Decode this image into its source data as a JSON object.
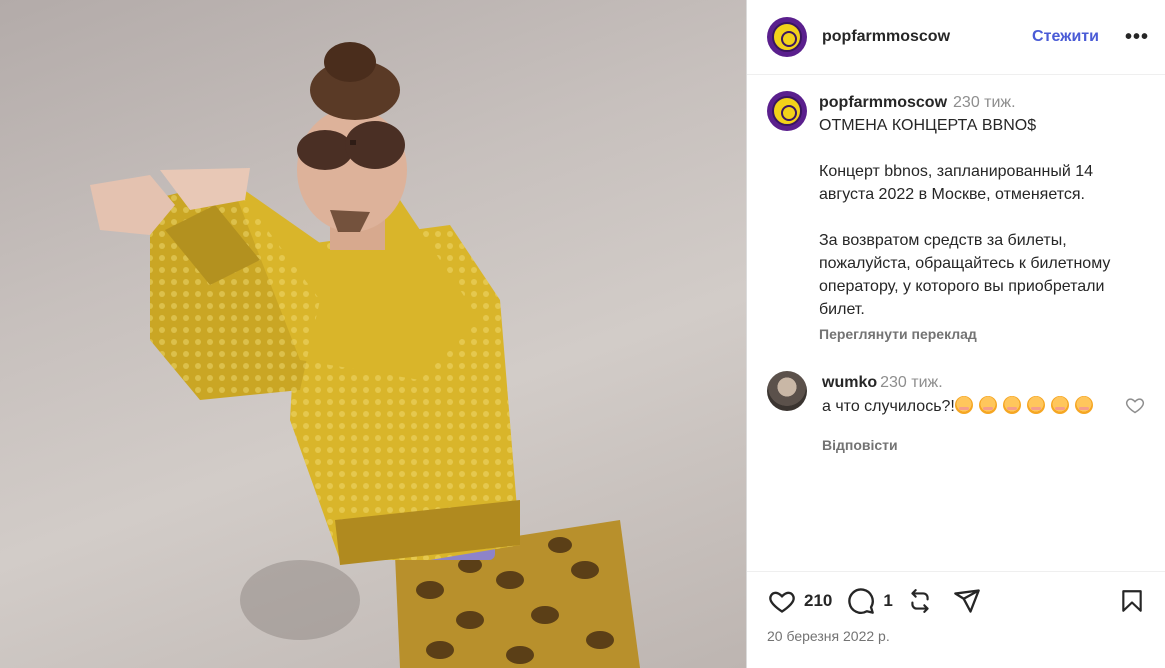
{
  "header": {
    "username": "popfarmmoscow",
    "follow_label": "Стежити",
    "more_label": "•••"
  },
  "caption": {
    "username": "popfarmmoscow",
    "time": "230 тиж.",
    "text": "ОТМЕНА КОНЦЕРТА BBNO$\n\nКонцерт bbnos, запланированный 14 августа 2022 в Москве, отменяется.\n\nЗа возвратом средств за билеты, пожалуйста, обращайтесь к билетному оператору, у которого вы приобретали билет.",
    "translate_label": "Переглянути переклад"
  },
  "comment": {
    "username": "wumko",
    "time": "230 тиж.",
    "text": "а что случилось?!",
    "emoji_count": 6,
    "emoji_name": "flushed-face",
    "reply_label": "Відповісти"
  },
  "actions": {
    "likes": "210",
    "comments": "1",
    "date": "20 березня 2022 р."
  },
  "colors": {
    "follow": "#4a5bd6",
    "secondary_text": "#737373",
    "sweater": "#d9b52a",
    "logo_bg": "#5a1f8d",
    "logo_fg": "#f2d21a"
  }
}
